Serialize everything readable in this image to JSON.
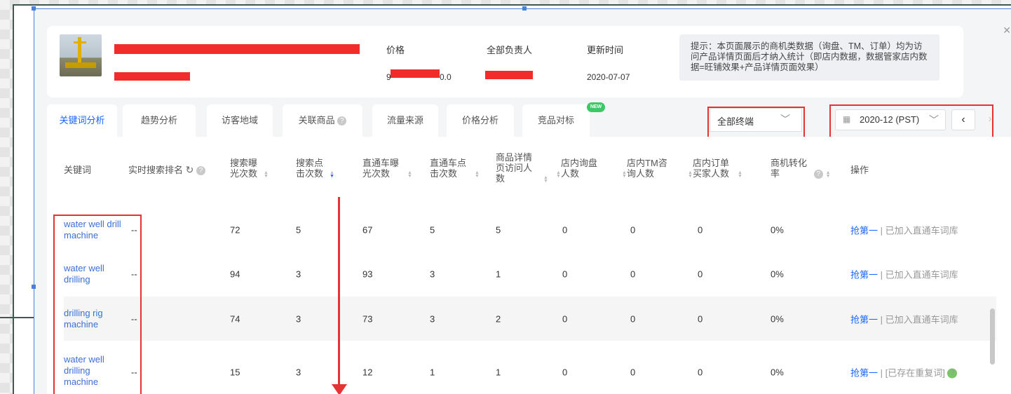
{
  "header": {
    "price_label": "价格",
    "price_value_suffix": "0.0",
    "price_value_prefix": "9",
    "owner_label": "全部负责人",
    "update_label": "更新时间",
    "update_value": "2020-07-07",
    "tip": "提示：本页面展示的商机类数据（询盘、TM、订单）均为访问产品详情页面后才纳入统计（即店内数据，数据管家店内数据=旺铺效果+产品详情页面效果）"
  },
  "tabs": [
    {
      "label": "关键词分析"
    },
    {
      "label": "趋势分析"
    },
    {
      "label": "访客地域"
    },
    {
      "label": "关联商品"
    },
    {
      "label": "流量来源"
    },
    {
      "label": "价格分析"
    },
    {
      "label": "竞品对标"
    }
  ],
  "new_badge": "NEW",
  "filters": {
    "terminal": "全部终端",
    "date": "2020-12 (PST)"
  },
  "columns": {
    "keyword": "关键词",
    "rank": "实时搜索排名",
    "search_exposure": "搜索曝光次数",
    "search_clicks": "搜索点击次数",
    "p4p_exposure": "直通车曝光次数",
    "p4p_clicks": "直通车点击次数",
    "detail_visitors": "商品详情页访问人数",
    "inquiry": "店内询盘人数",
    "tm": "店内TM咨询人数",
    "orders": "店内订单买家人数",
    "conversion": "商机转化率",
    "action": "操作"
  },
  "rows": [
    {
      "keyword": "water well drill machine",
      "rank": "--",
      "se": "72",
      "sc": "5",
      "pe": "67",
      "pc": "5",
      "dv": "5",
      "inq": "0",
      "tm": "0",
      "ord": "0",
      "conv": "0%",
      "act1": "抢第一",
      "act2": "已加入直通车词库"
    },
    {
      "keyword": "water well drilling",
      "rank": "--",
      "se": "94",
      "sc": "3",
      "pe": "93",
      "pc": "3",
      "dv": "1",
      "inq": "0",
      "tm": "0",
      "ord": "0",
      "conv": "0%",
      "act1": "抢第一",
      "act2": "已加入直通车词库"
    },
    {
      "keyword": "drilling rig machine",
      "rank": "--",
      "se": "74",
      "sc": "3",
      "pe": "73",
      "pc": "3",
      "dv": "2",
      "inq": "0",
      "tm": "0",
      "ord": "0",
      "conv": "0%",
      "act1": "抢第一",
      "act2": "已加入直通车词库"
    },
    {
      "keyword": "water well drilling machine",
      "rank": "--",
      "se": "15",
      "sc": "3",
      "pe": "12",
      "pc": "1",
      "dv": "1",
      "inq": "0",
      "tm": "0",
      "ord": "0",
      "conv": "0%",
      "act1": "抢第一",
      "act2": "[已存在重复词]"
    }
  ]
}
